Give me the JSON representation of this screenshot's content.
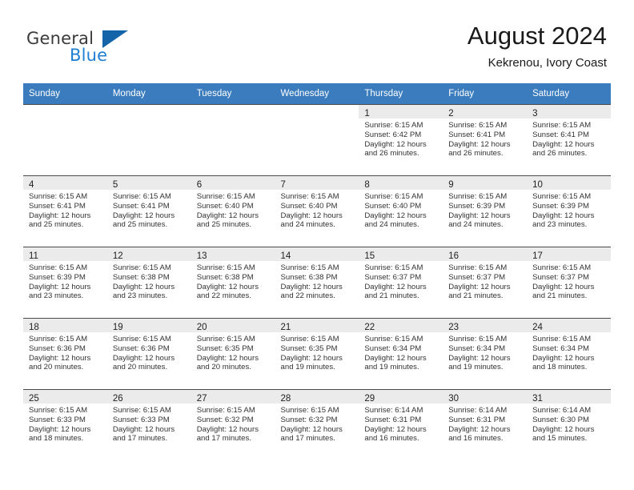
{
  "logo": {
    "word_one": "General",
    "word_two": "Blue",
    "triangle_icon": "triangle-icon"
  },
  "header": {
    "month_title": "August 2024",
    "location": "Kekrenou, Ivory Coast"
  },
  "colors": {
    "header_band": "#3a7cbe",
    "daynum_band": "#ebebeb",
    "cell_border": "#4a4a4a",
    "logo_blue": "#1f7fd4",
    "logo_triangle": "#1464aa"
  },
  "calendar": {
    "weekday_headers": [
      "Sunday",
      "Monday",
      "Tuesday",
      "Wednesday",
      "Thursday",
      "Friday",
      "Saturday"
    ],
    "weeks": [
      [
        {
          "day": "",
          "blank": true
        },
        {
          "day": "",
          "blank": true
        },
        {
          "day": "",
          "blank": true
        },
        {
          "day": "",
          "blank": true
        },
        {
          "day": "1",
          "sunrise": "Sunrise: 6:15 AM",
          "sunset": "Sunset: 6:42 PM",
          "daylight_1": "Daylight: 12 hours",
          "daylight_2": "and 26 minutes."
        },
        {
          "day": "2",
          "sunrise": "Sunrise: 6:15 AM",
          "sunset": "Sunset: 6:41 PM",
          "daylight_1": "Daylight: 12 hours",
          "daylight_2": "and 26 minutes."
        },
        {
          "day": "3",
          "sunrise": "Sunrise: 6:15 AM",
          "sunset": "Sunset: 6:41 PM",
          "daylight_1": "Daylight: 12 hours",
          "daylight_2": "and 26 minutes."
        }
      ],
      [
        {
          "day": "4",
          "sunrise": "Sunrise: 6:15 AM",
          "sunset": "Sunset: 6:41 PM",
          "daylight_1": "Daylight: 12 hours",
          "daylight_2": "and 25 minutes."
        },
        {
          "day": "5",
          "sunrise": "Sunrise: 6:15 AM",
          "sunset": "Sunset: 6:41 PM",
          "daylight_1": "Daylight: 12 hours",
          "daylight_2": "and 25 minutes."
        },
        {
          "day": "6",
          "sunrise": "Sunrise: 6:15 AM",
          "sunset": "Sunset: 6:40 PM",
          "daylight_1": "Daylight: 12 hours",
          "daylight_2": "and 25 minutes."
        },
        {
          "day": "7",
          "sunrise": "Sunrise: 6:15 AM",
          "sunset": "Sunset: 6:40 PM",
          "daylight_1": "Daylight: 12 hours",
          "daylight_2": "and 24 minutes."
        },
        {
          "day": "8",
          "sunrise": "Sunrise: 6:15 AM",
          "sunset": "Sunset: 6:40 PM",
          "daylight_1": "Daylight: 12 hours",
          "daylight_2": "and 24 minutes."
        },
        {
          "day": "9",
          "sunrise": "Sunrise: 6:15 AM",
          "sunset": "Sunset: 6:39 PM",
          "daylight_1": "Daylight: 12 hours",
          "daylight_2": "and 24 minutes."
        },
        {
          "day": "10",
          "sunrise": "Sunrise: 6:15 AM",
          "sunset": "Sunset: 6:39 PM",
          "daylight_1": "Daylight: 12 hours",
          "daylight_2": "and 23 minutes."
        }
      ],
      [
        {
          "day": "11",
          "sunrise": "Sunrise: 6:15 AM",
          "sunset": "Sunset: 6:39 PM",
          "daylight_1": "Daylight: 12 hours",
          "daylight_2": "and 23 minutes."
        },
        {
          "day": "12",
          "sunrise": "Sunrise: 6:15 AM",
          "sunset": "Sunset: 6:38 PM",
          "daylight_1": "Daylight: 12 hours",
          "daylight_2": "and 23 minutes."
        },
        {
          "day": "13",
          "sunrise": "Sunrise: 6:15 AM",
          "sunset": "Sunset: 6:38 PM",
          "daylight_1": "Daylight: 12 hours",
          "daylight_2": "and 22 minutes."
        },
        {
          "day": "14",
          "sunrise": "Sunrise: 6:15 AM",
          "sunset": "Sunset: 6:38 PM",
          "daylight_1": "Daylight: 12 hours",
          "daylight_2": "and 22 minutes."
        },
        {
          "day": "15",
          "sunrise": "Sunrise: 6:15 AM",
          "sunset": "Sunset: 6:37 PM",
          "daylight_1": "Daylight: 12 hours",
          "daylight_2": "and 21 minutes."
        },
        {
          "day": "16",
          "sunrise": "Sunrise: 6:15 AM",
          "sunset": "Sunset: 6:37 PM",
          "daylight_1": "Daylight: 12 hours",
          "daylight_2": "and 21 minutes."
        },
        {
          "day": "17",
          "sunrise": "Sunrise: 6:15 AM",
          "sunset": "Sunset: 6:37 PM",
          "daylight_1": "Daylight: 12 hours",
          "daylight_2": "and 21 minutes."
        }
      ],
      [
        {
          "day": "18",
          "sunrise": "Sunrise: 6:15 AM",
          "sunset": "Sunset: 6:36 PM",
          "daylight_1": "Daylight: 12 hours",
          "daylight_2": "and 20 minutes."
        },
        {
          "day": "19",
          "sunrise": "Sunrise: 6:15 AM",
          "sunset": "Sunset: 6:36 PM",
          "daylight_1": "Daylight: 12 hours",
          "daylight_2": "and 20 minutes."
        },
        {
          "day": "20",
          "sunrise": "Sunrise: 6:15 AM",
          "sunset": "Sunset: 6:35 PM",
          "daylight_1": "Daylight: 12 hours",
          "daylight_2": "and 20 minutes."
        },
        {
          "day": "21",
          "sunrise": "Sunrise: 6:15 AM",
          "sunset": "Sunset: 6:35 PM",
          "daylight_1": "Daylight: 12 hours",
          "daylight_2": "and 19 minutes."
        },
        {
          "day": "22",
          "sunrise": "Sunrise: 6:15 AM",
          "sunset": "Sunset: 6:34 PM",
          "daylight_1": "Daylight: 12 hours",
          "daylight_2": "and 19 minutes."
        },
        {
          "day": "23",
          "sunrise": "Sunrise: 6:15 AM",
          "sunset": "Sunset: 6:34 PM",
          "daylight_1": "Daylight: 12 hours",
          "daylight_2": "and 19 minutes."
        },
        {
          "day": "24",
          "sunrise": "Sunrise: 6:15 AM",
          "sunset": "Sunset: 6:34 PM",
          "daylight_1": "Daylight: 12 hours",
          "daylight_2": "and 18 minutes."
        }
      ],
      [
        {
          "day": "25",
          "sunrise": "Sunrise: 6:15 AM",
          "sunset": "Sunset: 6:33 PM",
          "daylight_1": "Daylight: 12 hours",
          "daylight_2": "and 18 minutes."
        },
        {
          "day": "26",
          "sunrise": "Sunrise: 6:15 AM",
          "sunset": "Sunset: 6:33 PM",
          "daylight_1": "Daylight: 12 hours",
          "daylight_2": "and 17 minutes."
        },
        {
          "day": "27",
          "sunrise": "Sunrise: 6:15 AM",
          "sunset": "Sunset: 6:32 PM",
          "daylight_1": "Daylight: 12 hours",
          "daylight_2": "and 17 minutes."
        },
        {
          "day": "28",
          "sunrise": "Sunrise: 6:15 AM",
          "sunset": "Sunset: 6:32 PM",
          "daylight_1": "Daylight: 12 hours",
          "daylight_2": "and 17 minutes."
        },
        {
          "day": "29",
          "sunrise": "Sunrise: 6:14 AM",
          "sunset": "Sunset: 6:31 PM",
          "daylight_1": "Daylight: 12 hours",
          "daylight_2": "and 16 minutes."
        },
        {
          "day": "30",
          "sunrise": "Sunrise: 6:14 AM",
          "sunset": "Sunset: 6:31 PM",
          "daylight_1": "Daylight: 12 hours",
          "daylight_2": "and 16 minutes."
        },
        {
          "day": "31",
          "sunrise": "Sunrise: 6:14 AM",
          "sunset": "Sunset: 6:30 PM",
          "daylight_1": "Daylight: 12 hours",
          "daylight_2": "and 15 minutes."
        }
      ]
    ]
  }
}
